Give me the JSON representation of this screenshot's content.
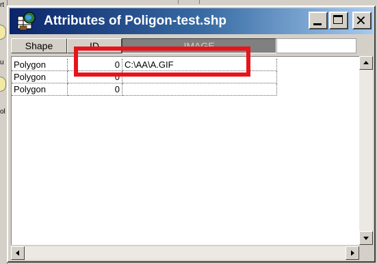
{
  "window": {
    "title": "Attributes of Poligon-test.shp",
    "icon": "table-globe-icon"
  },
  "controls": {
    "minimize_icon": "minimize-icon",
    "maximize_icon": "maximize-icon",
    "close_icon": "close-icon"
  },
  "table": {
    "columns": [
      "Shape",
      "ID",
      "IMAGE"
    ],
    "selected_column": "IMAGE",
    "rows": [
      {
        "shape": "Polygon",
        "id": "0",
        "image": "C:\\AA\\A.GIF"
      },
      {
        "shape": "Polygon",
        "id": "0",
        "image": ""
      },
      {
        "shape": "Polygon",
        "id": "0",
        "image": ""
      }
    ]
  },
  "background_fragments": {
    "frag1": "rt",
    "frag2": "u",
    "frag3": "ol"
  },
  "colors": {
    "titlebar_start": "#0a246a",
    "titlebar_end": "#a6caf0",
    "highlight": "#e8131b",
    "selected_header": "#808080"
  }
}
